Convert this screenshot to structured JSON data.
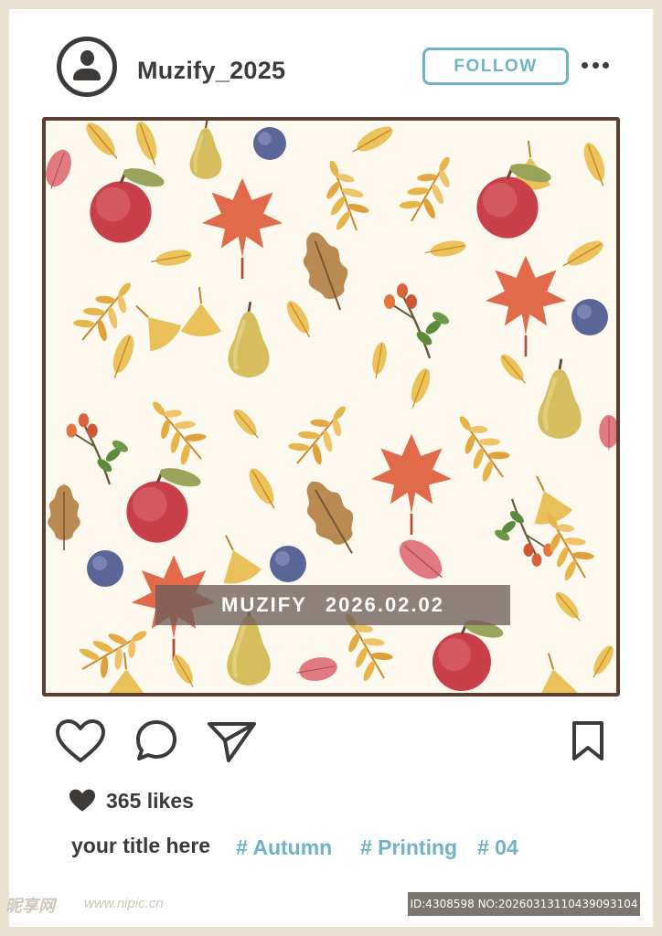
{
  "post": {
    "username": "Muzify_2025",
    "follow_label": "FOLLOW",
    "more_icon": "more-dots-icon",
    "image_watermark_brand": "MUZIFY",
    "image_watermark_date": "2026.02.02",
    "likes": "365 likes",
    "caption": "your title here",
    "tags": [
      "# Autumn",
      "# Printing",
      "# 04"
    ]
  },
  "actions": {
    "like_icon": "heart-outline-icon",
    "comment_icon": "comment-icon",
    "share_icon": "send-icon",
    "save_icon": "bookmark-icon"
  },
  "credits": {
    "site_logo": "昵享网",
    "site_url": "www.nipic.cn",
    "id_line": "ID:4308598 NO:20260313110439093104"
  },
  "colors": {
    "accent": "#6fb3c8",
    "text": "#3d3a38",
    "frame": "#5b3f33",
    "background": "#e9e2d3"
  }
}
